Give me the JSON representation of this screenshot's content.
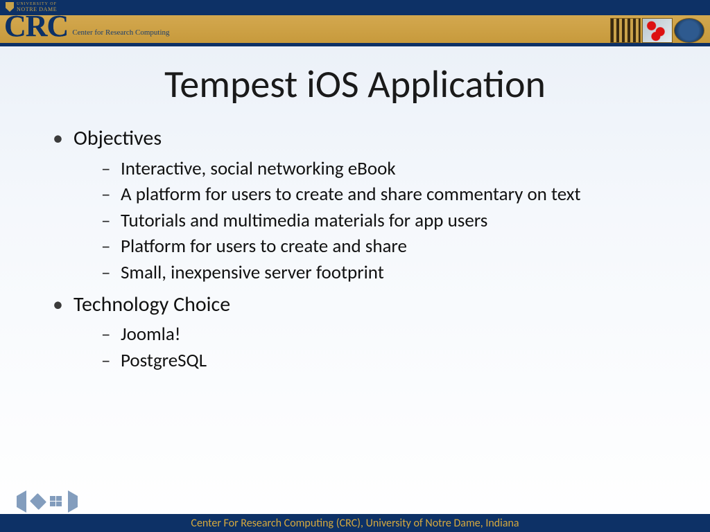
{
  "header": {
    "university_line1": "UNIVERSITY OF",
    "university_line2": "NOTRE DAME",
    "crc_logo_text": "CRC",
    "crc_subtitle": "Center for Research Computing"
  },
  "title": "Tempest iOS Application",
  "bullets": [
    {
      "label": "Objectives",
      "children": [
        "Interactive, social networking eBook",
        "A platform for users to create and share commentary on text",
        "Tutorials and multimedia materials for app users",
        "Platform for users to create and share",
        "Small, inexpensive server footprint"
      ]
    },
    {
      "label": "Technology Choice",
      "children": [
        "Joomla!",
        "PostgreSQL"
      ]
    }
  ],
  "footer": {
    "text": "Center For Research Computing (CRC), University of Notre Dame, Indiana"
  }
}
